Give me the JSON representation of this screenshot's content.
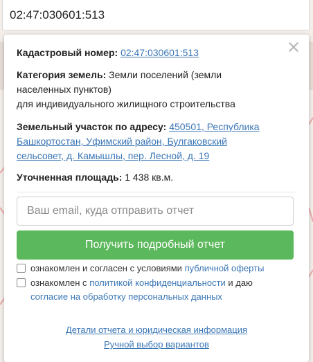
{
  "search": {
    "value": "02:47:030601:513"
  },
  "popup": {
    "cadastral": {
      "label": "Кадастровый номер:",
      "value": "02:47:030601:513"
    },
    "category": {
      "label": "Категория земель:",
      "line1": "Земли поселений (земли",
      "line2": "населенных пунктов)",
      "line3": "для индивидуального жилищного строительства"
    },
    "address": {
      "label": "Земельный участок по адресу:",
      "link_part1": "450501, Республика",
      "link_part2": "Башкортостан, Уфимский район, Булгаковский",
      "link_part3": "сельсовет, д. Камышлы, пер. Лесной, д. 19"
    },
    "area": {
      "label": "Уточненная площадь:",
      "value": "1 438 кв.м."
    },
    "email": {
      "placeholder": "Ваш email, куда отправить отчет"
    },
    "submit_label": "Получить подробный отчет",
    "consent1": {
      "text": "ознакомлен и согласен с условиями ",
      "link": "публичной оферты"
    },
    "consent2": {
      "text_before": "ознакомлен с ",
      "link1": "политикой конфиденциальности",
      "text_mid": " и даю",
      "link2": "согласие на обработку персональных данных"
    },
    "footer": {
      "details_link": "Детали отчета и юридическая информация",
      "manual_link": "Ручной выбор вариантов"
    }
  },
  "colors": {
    "accent": "#5cb85c",
    "link": "#3a76b5",
    "map_background": "#f3eeea",
    "map_lines": "#e88a8a"
  }
}
